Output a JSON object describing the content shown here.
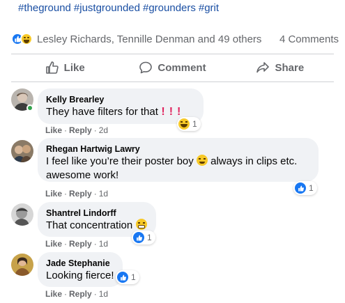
{
  "post": {
    "hashtags": [
      "#theground",
      "#justgrounded",
      "#grounders",
      "#grit"
    ],
    "reactors_text": "Lesley Richards, Tennille Denman and 49 others",
    "comment_count": "4 Comments"
  },
  "actions": {
    "like": "Like",
    "comment": "Comment",
    "share": "Share"
  },
  "comments": [
    {
      "author": "Kelly Brearley",
      "text": "They have filters for that",
      "trailing": "!!!",
      "like": "Like",
      "reply": "Reply",
      "time": "2d",
      "reaction_count": "1",
      "reaction_icon": "haha-reaction-icon"
    },
    {
      "author": "Rhegan Hartwig Lawry",
      "text_line1": "I feel like you’re their poster boy",
      "text_line1b": "always in clips etc.",
      "text_line2": "awesome work!",
      "like": "Like",
      "reply": "Reply",
      "time": "1d",
      "reaction_count": "1",
      "reaction_icon": "like-reaction-icon"
    },
    {
      "author": "Shantrel Lindorff",
      "text": "That concentration",
      "like": "Like",
      "reply": "Reply",
      "time": "1d",
      "reaction_count": "1",
      "reaction_icon": "like-reaction-icon"
    },
    {
      "author": "Jade Stephanie",
      "text": "Looking fierce!",
      "like": "Like",
      "reply": "Reply",
      "time": "1d",
      "reaction_count": "1",
      "reaction_icon": "like-reaction-icon"
    }
  ],
  "colors": {
    "link_blue": "#1a4fa3",
    "meta_gray": "#65676b",
    "bubble_bg": "#f0f2f5",
    "like_blue": "#1877f2",
    "online_green": "#31a24c"
  }
}
